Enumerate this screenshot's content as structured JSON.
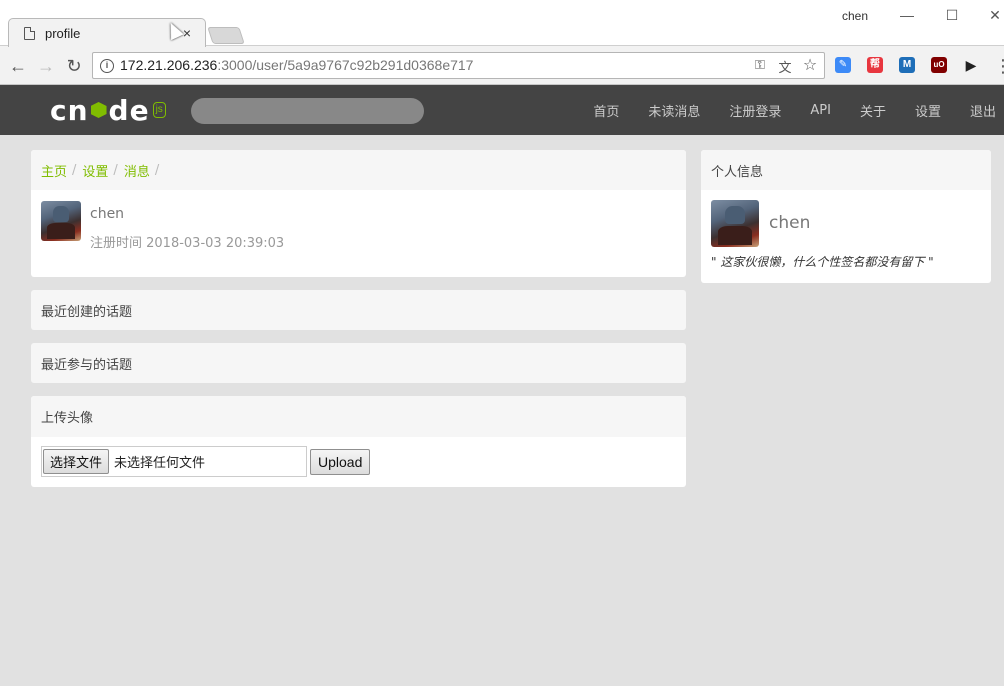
{
  "browser": {
    "tab_title": "profile",
    "close_glyph": "×",
    "window_user": "chen",
    "url_host": "172.21.206.236",
    "url_rest": ":3000/user/5a9a9767c92b291d0368e717",
    "minimize_glyph": "—",
    "maximize_glyph": "☐",
    "window_close_glyph": "✕",
    "back_glyph": "←",
    "forward_glyph": "→",
    "reload_glyph": "↻",
    "info_glyph": "i",
    "key_glyph": "⚿",
    "translate_glyph": "文",
    "star_glyph": "☆",
    "menu_glyph": "⋮",
    "extensions": [
      {
        "name": "ext-blue-icon",
        "label": "✎",
        "color": "#3d8af7"
      },
      {
        "name": "ext-red-icon",
        "label": "帮",
        "color": "#e8363f"
      },
      {
        "name": "ext-m-icon",
        "label": "M",
        "color": "#1e6eb8"
      },
      {
        "name": "ublock-icon",
        "label": "uO",
        "color": "#800000"
      },
      {
        "name": "play-icon",
        "label": "▶",
        "color": "#222222"
      }
    ]
  },
  "site": {
    "logo_letters_left": "cn",
    "logo_letters_right": "de",
    "logo_js": "js",
    "search_placeholder": "",
    "nav": [
      "首页",
      "未读消息",
      "注册登录",
      "API",
      "关于",
      "设置",
      "退出"
    ],
    "brand_color": "#80bd01"
  },
  "main": {
    "breadcrumb": [
      "主页",
      "设置",
      "消息"
    ],
    "breadcrumb_sep": "/",
    "user": {
      "name": "chen",
      "register_time": "注册时间 2018-03-03 20:39:03"
    },
    "recent_topics_title": "最近创建的话题",
    "recent_replies_title": "最近参与的话题",
    "upload_title": "上传头像",
    "choose_file_label": "选择文件",
    "no_file_label": "未选择任何文件",
    "upload_label": "Upload"
  },
  "sidebar": {
    "title": "个人信息",
    "name": "chen",
    "signature": "\" 这家伙很懒，什么个性签名都没有留下 \""
  }
}
